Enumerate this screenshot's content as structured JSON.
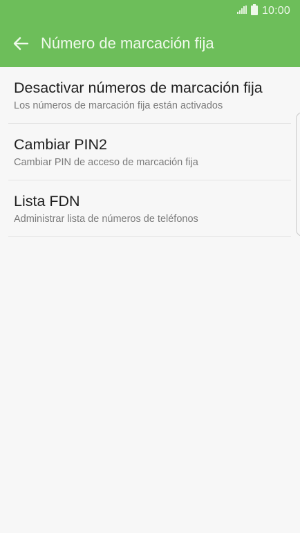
{
  "status_bar": {
    "time": "10:00",
    "icons": [
      "signal-icon",
      "battery-icon"
    ]
  },
  "toolbar": {
    "back_icon": "arrow-left-icon",
    "title": "Número de marcación fija"
  },
  "list": {
    "items": [
      {
        "title": "Desactivar números de marcación fija",
        "subtitle": "Los números de marcación fija están activados"
      },
      {
        "title": "Cambiar PIN2",
        "subtitle": "Cambiar PIN de acceso de marcación fija"
      },
      {
        "title": "Lista FDN",
        "subtitle": "Administrar lista de números de teléfonos"
      }
    ]
  },
  "colors": {
    "app_bar": "#6dbe5a",
    "background": "#f7f7f7",
    "title_text": "#1e1e1e",
    "subtitle_text": "#7a7a7a"
  }
}
